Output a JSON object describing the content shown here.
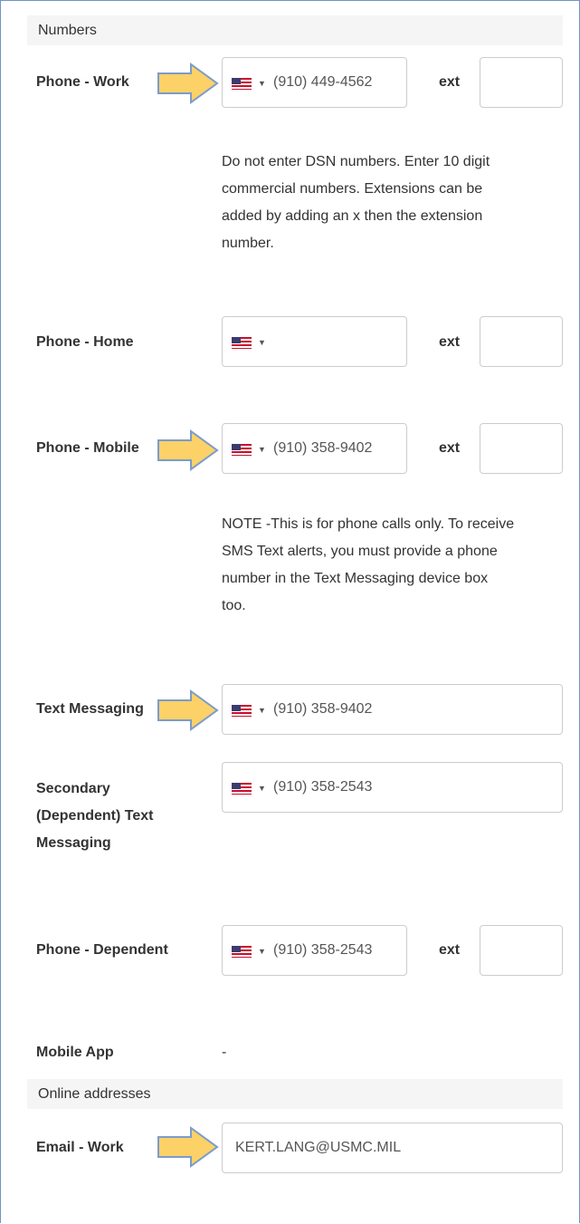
{
  "sections": {
    "numbers": "Numbers",
    "online": "Online addresses"
  },
  "work": {
    "label": "Phone - Work",
    "value": "(910) 449-4562",
    "ext_label": "ext",
    "ext_value": ""
  },
  "work_help": [
    "Do not enter DSN numbers. Enter 10 digit",
    "commercial numbers. Extensions can be",
    "added by adding an x then the extension",
    "number."
  ],
  "home": {
    "label": "Phone - Home",
    "value": "",
    "ext_label": "ext",
    "ext_value": ""
  },
  "mobile": {
    "label": "Phone - Mobile",
    "value": "(910) 358-9402",
    "ext_label": "ext",
    "ext_value": ""
  },
  "mobile_help": [
    "NOTE -This is for phone calls only. To receive",
    "SMS Text alerts, you must provide a phone",
    "number in the Text Messaging device box",
    "too."
  ],
  "text": {
    "label": "Text Messaging",
    "value": "(910) 358-9402"
  },
  "secondary": {
    "label_lines": [
      "Secondary",
      "(Dependent) Text",
      "Messaging"
    ],
    "value": "(910) 358-2543"
  },
  "dependent": {
    "label": "Phone - Dependent",
    "value": "(910) 358-2543",
    "ext_label": "ext",
    "ext_value": ""
  },
  "app": {
    "label": "Mobile App",
    "value": "-"
  },
  "email": {
    "label": "Email - Work",
    "value": "KERT.LANG@USMC.MIL"
  },
  "icons": {
    "flag": "us-flag-icon",
    "caret": "caret-down-icon",
    "arrow": "arrow-right-icon"
  },
  "colors": {
    "arrow_fill": "#fcd167",
    "arrow_stroke": "#7a9ccc",
    "border": "#6f93c6",
    "field_border": "#cccccc"
  }
}
